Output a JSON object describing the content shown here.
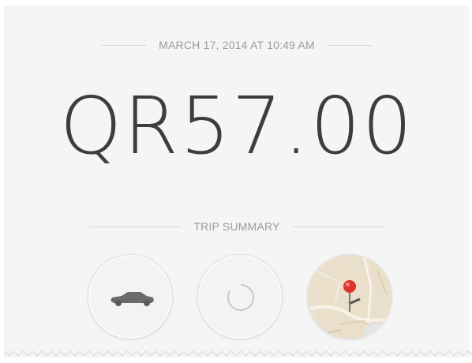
{
  "receipt": {
    "timestamp": "MARCH 17, 2014 AT 10:49 AM",
    "fare": "QR57.00",
    "trip_summary_label": "TRIP SUMMARY"
  },
  "icons": {
    "vehicle": "car-icon",
    "loading": "loading-spinner-icon",
    "map": "map-pin-icon"
  },
  "colors": {
    "background": "#f5f5f5",
    "text_dark": "#3d3d3d",
    "text_muted": "#9b9b9b",
    "pin_red": "#e0312c"
  }
}
